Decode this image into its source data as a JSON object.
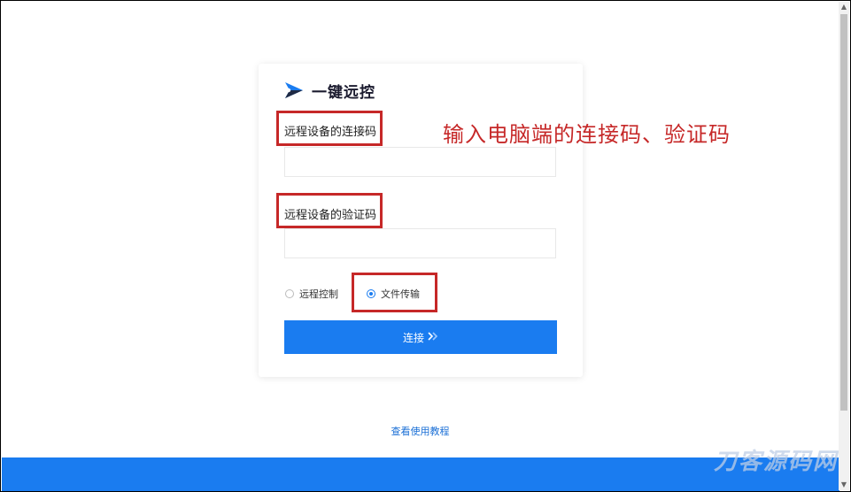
{
  "brand": {
    "name": "一键远控",
    "icon": "brand-logo-icon",
    "accent": "#1a7cf0"
  },
  "form": {
    "connection_code_label": "远程设备的连接码",
    "connection_code_value": "",
    "verification_code_label": "远程设备的验证码",
    "verification_code_value": "",
    "mode_options": [
      {
        "label": "远程控制",
        "selected": false
      },
      {
        "label": "文件传输",
        "selected": true
      }
    ],
    "connect_label": "连接",
    "connect_icon": "double-chevron-right-icon"
  },
  "footer": {
    "tutorial_link": "查看使用教程",
    "band_color": "#1a7cf0"
  },
  "annotation": {
    "note": "输入电脑端的连接码、验证码",
    "color": "#c62828"
  },
  "watermark": {
    "text": "刀客源码网"
  }
}
